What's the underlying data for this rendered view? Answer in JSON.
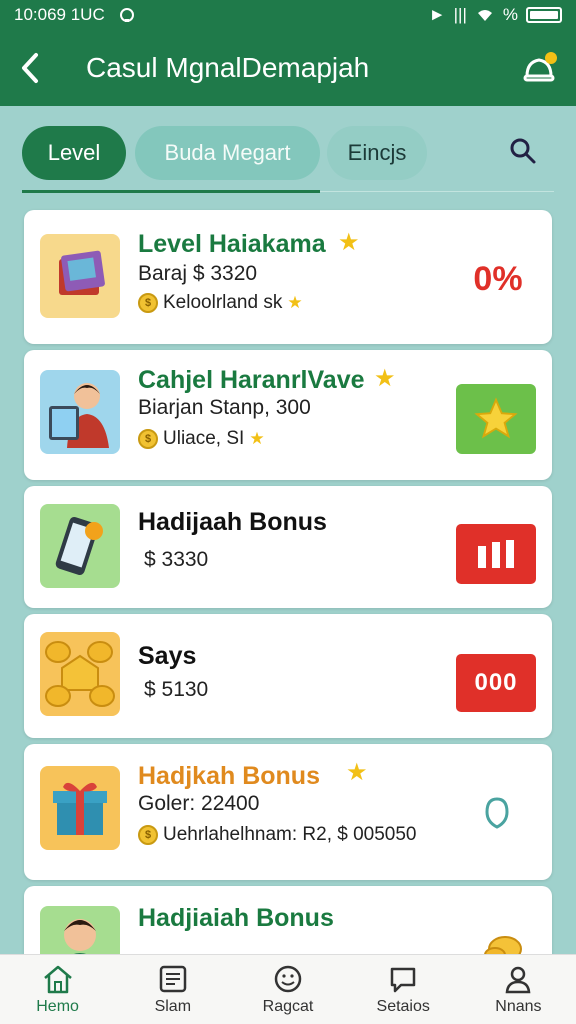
{
  "status_bar": {
    "time": "10:069 1UC",
    "right_glyph": "►",
    "signal": "|||",
    "percent": "%"
  },
  "app_bar": {
    "title": "Casul MgnalDemapjah"
  },
  "tabs": [
    {
      "label": "Level",
      "active": true
    },
    {
      "label": "Buda Megart",
      "active": false
    },
    {
      "label": "Eincjs",
      "active": false
    }
  ],
  "cards": [
    {
      "title": "Level Haiakama",
      "title_color": "#1a7a40",
      "line1": "Baraj $ 3320",
      "line2": "Keloolrland sk",
      "badge": "0%",
      "icon": "book-icon"
    },
    {
      "title": "Cahjel HaranrlVave",
      "title_color": "#1a7a40",
      "line1": "Biarjan Stanp, 300",
      "line2": "Uliace, SI",
      "badge": "star-badge",
      "icon": "person-tablet-icon"
    },
    {
      "title": "Hadijaah Bonus",
      "title_color": "#111111",
      "line1": "$ 3330",
      "badge": "bars-badge",
      "icon": "phone-icon"
    },
    {
      "title": "Says",
      "title_color": "#111111",
      "line1": "$ 5130",
      "badge": "000",
      "icon": "coins-icon"
    },
    {
      "title": "Hadjkah Bonus",
      "title_color": "#e08a1e",
      "line1": "Goler: 22400",
      "line2": "Uehrlahelhnam: R2, $ 005050",
      "badge": "ring-badge",
      "icon": "gift-icon"
    },
    {
      "title": "Hadjiaiah Bonus",
      "title_color": "#1a7a40",
      "line1": "",
      "badge": "coin-badge",
      "icon": "person-icon"
    }
  ],
  "bottom_nav": [
    {
      "label": "Hemo",
      "icon": "home-icon",
      "active": true
    },
    {
      "label": "Slam",
      "icon": "list-icon",
      "active": false
    },
    {
      "label": "Ragcat",
      "icon": "smile-icon",
      "active": false
    },
    {
      "label": "Setaios",
      "icon": "chat-icon",
      "active": false
    },
    {
      "label": "Nnans",
      "icon": "profile-icon",
      "active": false
    }
  ],
  "colors": {
    "primary": "#1f7a4a",
    "background": "#9fd1cc",
    "red": "#e03029",
    "green_badge": "#6cc04a",
    "gold": "#f2c016"
  }
}
